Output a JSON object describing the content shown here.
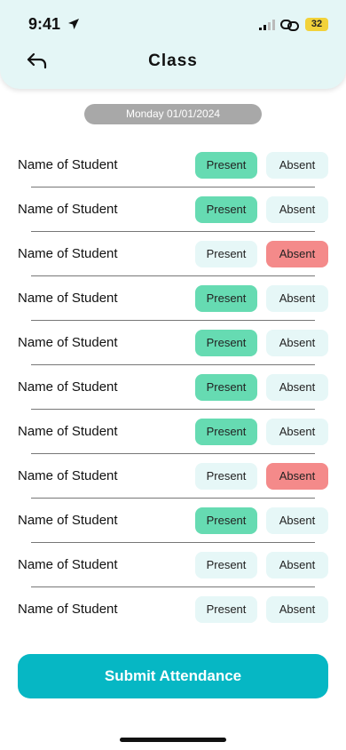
{
  "status_bar": {
    "time": "9:41",
    "battery": "32"
  },
  "header": {
    "title": "Class",
    "back_icon": "back-arrow-icon"
  },
  "date": "Monday 01/01/2024",
  "students": [
    {
      "name": "Name of Student",
      "present_label": "Present",
      "absent_label": "Absent",
      "status": "present"
    },
    {
      "name": "Name of Student",
      "present_label": "Present",
      "absent_label": "Absent",
      "status": "present"
    },
    {
      "name": "Name of Student",
      "present_label": "Present",
      "absent_label": "Absent",
      "status": "absent"
    },
    {
      "name": "Name of Student",
      "present_label": "Present",
      "absent_label": "Absent",
      "status": "present"
    },
    {
      "name": "Name of Student",
      "present_label": "Present",
      "absent_label": "Absent",
      "status": "present"
    },
    {
      "name": "Name of Student",
      "present_label": "Present",
      "absent_label": "Absent",
      "status": "present"
    },
    {
      "name": "Name of Student",
      "present_label": "Present",
      "absent_label": "Absent",
      "status": "present"
    },
    {
      "name": "Name of Student",
      "present_label": "Present",
      "absent_label": "Absent",
      "status": "absent"
    },
    {
      "name": "Name of Student",
      "present_label": "Present",
      "absent_label": "Absent",
      "status": "present"
    },
    {
      "name": "Name of Student",
      "present_label": "Present",
      "absent_label": "Absent",
      "status": "none"
    },
    {
      "name": "Name of Student",
      "present_label": "Present",
      "absent_label": "Absent",
      "status": "none"
    }
  ],
  "submit_label": "Submit Attendance",
  "colors": {
    "header_bg": "#e4f6f6",
    "present_active": "#66dbb2",
    "absent_active": "#f48a8a",
    "inactive": "#e6f7f7",
    "submit": "#06b7c4",
    "date_pill": "#a8a8a8"
  }
}
